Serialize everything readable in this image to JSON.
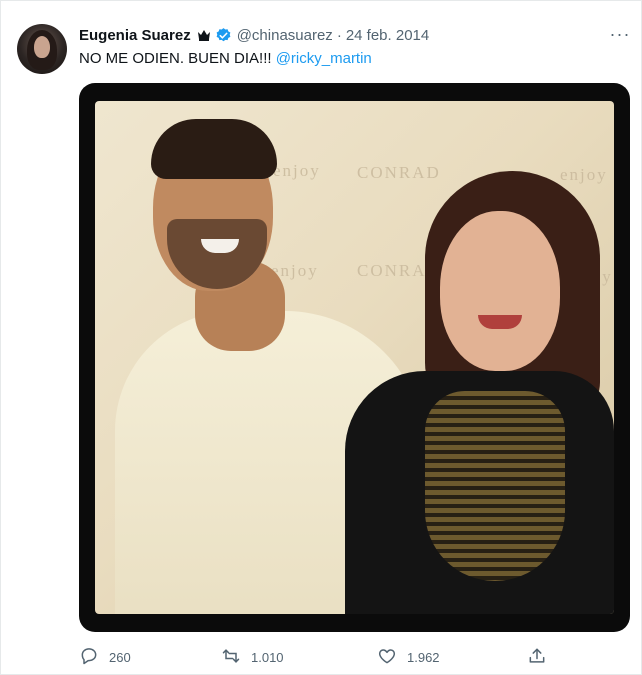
{
  "tweet": {
    "author_name": "Eugenia Suarez",
    "handle": "@chinasuarez",
    "separator": "·",
    "date": "24 feb. 2014",
    "text": "NO ME ODIEN. BUEN DIA!!!",
    "mention": "@ricky_martin",
    "more_label": "···",
    "photo_bg_texts": [
      "enjoy",
      "CONRAD",
      "enjoy",
      "enjoy",
      "CONRAD",
      "enjoy"
    ],
    "icons": {
      "crown": "crown-icon",
      "verified": "verified-badge-icon",
      "reply": "reply-icon",
      "retweet": "retweet-icon",
      "like": "heart-icon",
      "share": "share-icon",
      "more": "more-options-icon"
    },
    "verified_color": "#1d9bf0",
    "counts": {
      "replies": "260",
      "retweets": "1.010",
      "likes": "1.962"
    }
  }
}
